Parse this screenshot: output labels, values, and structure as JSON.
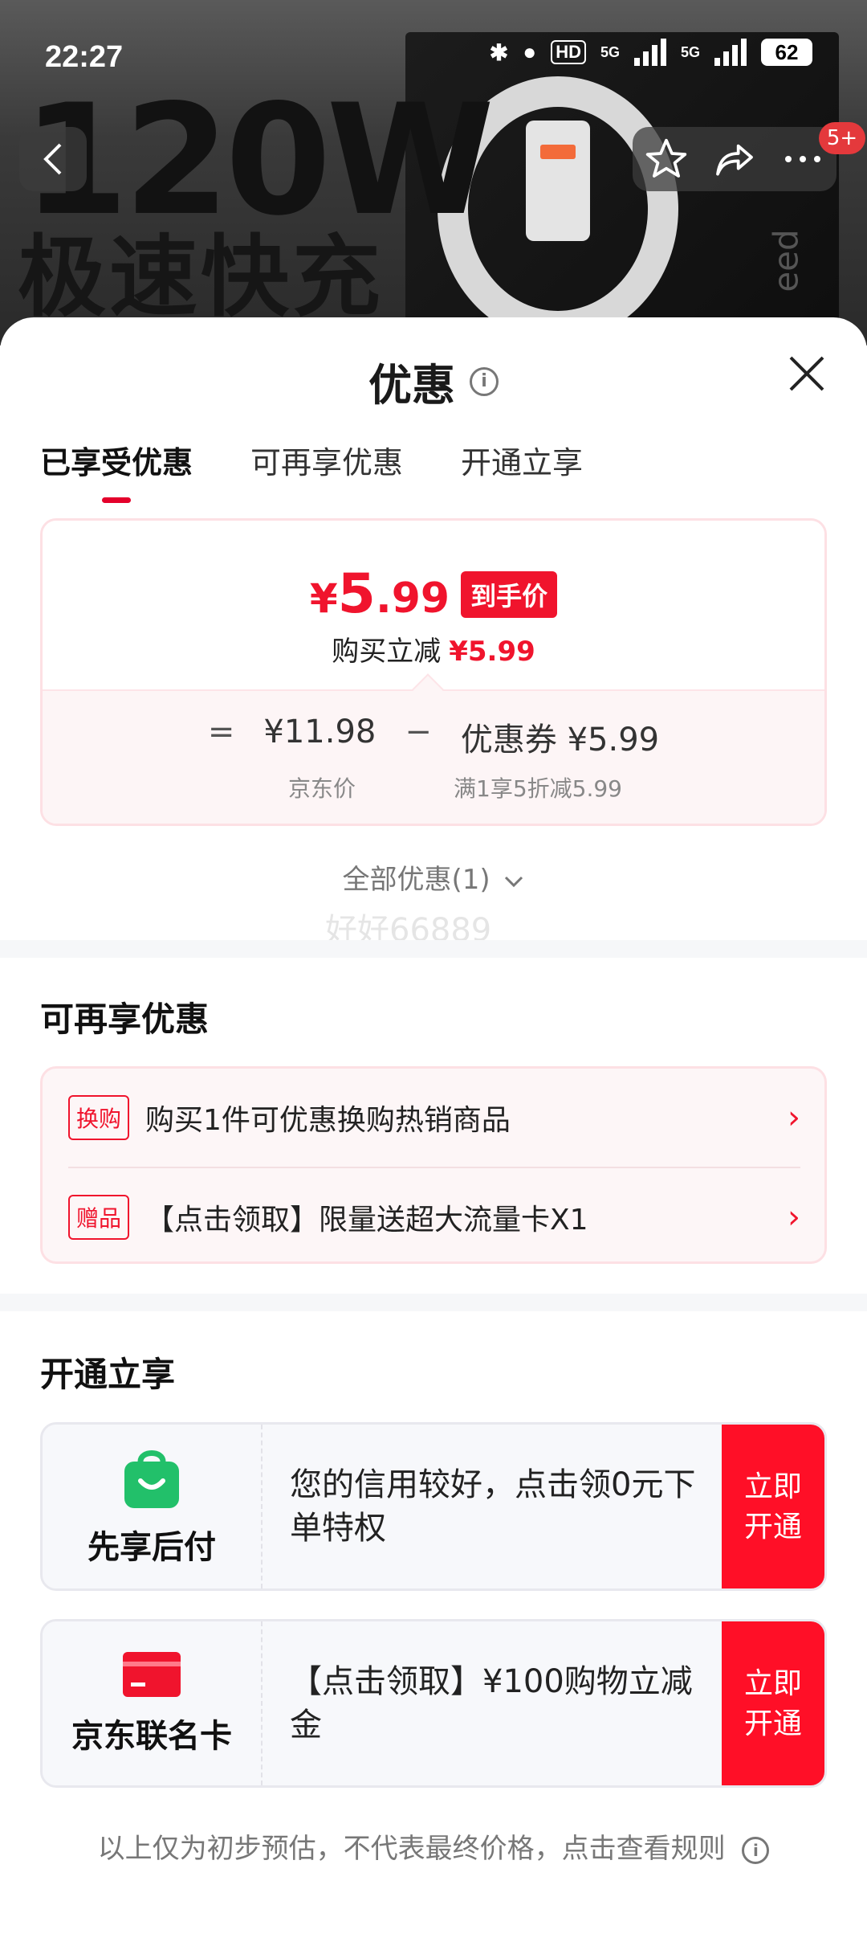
{
  "status_bar": {
    "time": "22:27",
    "hd_label": "HD",
    "net1": "5G",
    "net2": "5G",
    "battery": "62"
  },
  "product_banner": {
    "headline": "120W",
    "subline": "极速快充",
    "side_text": "eed"
  },
  "nav": {
    "cart_badge": "5+"
  },
  "sheet": {
    "title": "优惠",
    "tabs": [
      {
        "label": "已享受优惠"
      },
      {
        "label": "可再享优惠"
      },
      {
        "label": "开通立享"
      }
    ],
    "price_card": {
      "currency": "¥",
      "price_integer": "5",
      "price_decimal": ".99",
      "price_tag": "到手价",
      "instant_discount_label": "购买立减",
      "instant_discount_value": "¥5.99",
      "formula_eq": "=",
      "jd_price": "¥11.98",
      "formula_minus": "−",
      "coupon_label": "优惠券",
      "coupon_value": "¥5.99",
      "jd_price_label": "京东价",
      "coupon_rule": "满1享5折减5.99"
    },
    "all_offers": "全部优惠(1)",
    "watermark": "好好66889",
    "more_offers": {
      "title": "可再享优惠",
      "items": [
        {
          "tag": "换购",
          "text": "购买1件可优惠换购热销商品"
        },
        {
          "tag": "赠品",
          "text": "【点击领取】限量送超大流量卡X1"
        }
      ]
    },
    "activate": {
      "title": "开通立享",
      "items": [
        {
          "name": "先享后付",
          "desc": "您的信用较好，点击领0元下单特权",
          "button": "立即开通"
        },
        {
          "name": "京东联名卡",
          "desc": "【点击领取】¥100购物立减金",
          "button": "立即开通"
        }
      ]
    },
    "footer_note": "以上仅为初步预估，不代表最终价格，点击查看规则"
  },
  "colors": {
    "accent": "#f0142d",
    "button": "#ff0f27",
    "pay_green": "#22c06a"
  }
}
